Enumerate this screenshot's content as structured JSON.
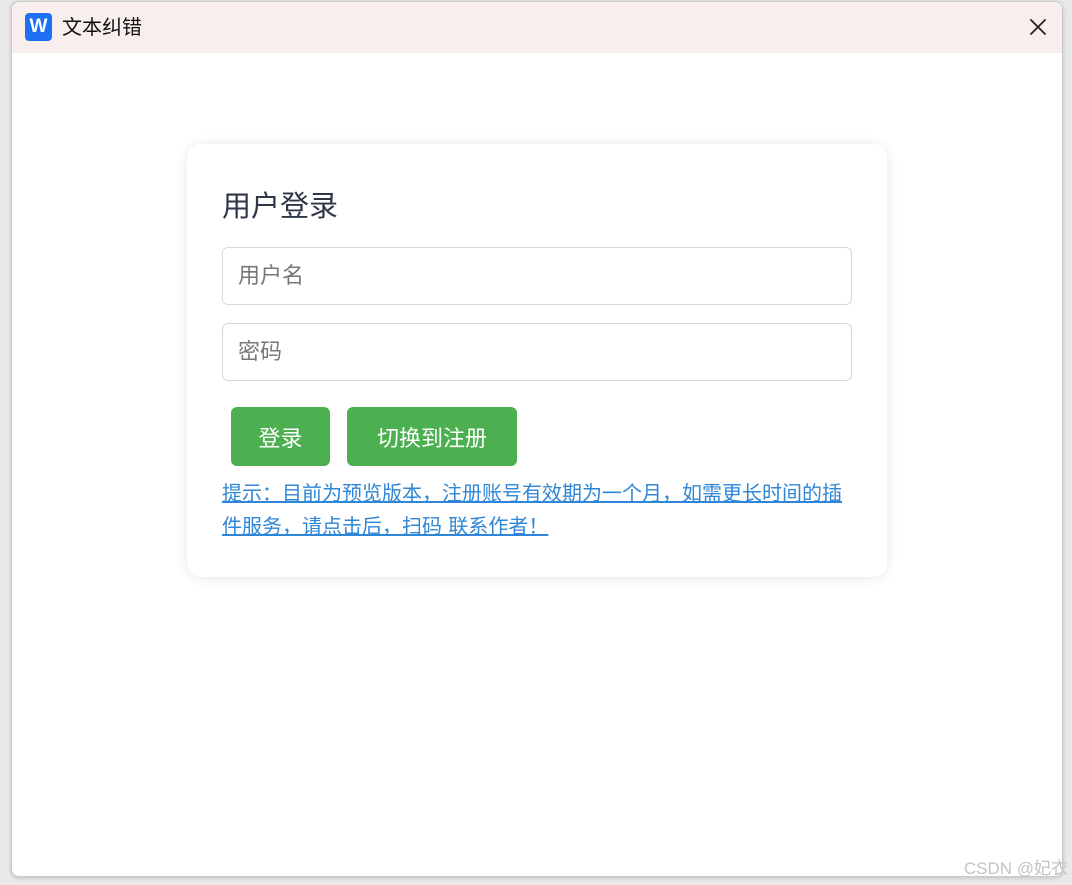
{
  "window": {
    "title": "文本纠错",
    "logo_letter": "W",
    "logo_color": "#1e6ff2",
    "close_icon": "close-icon"
  },
  "login": {
    "title": "用户登录",
    "username_placeholder": "用户名",
    "password_placeholder": "密码",
    "login_button": "登录",
    "switch_button": "切换到注册",
    "button_color": "#4caf50",
    "hint": "提示：目前为预览版本，注册账号有效期为一个月，如需更长时间的插件服务，请点击后，扫码 联系作者！",
    "hint_color": "#2f86d6"
  },
  "watermark": "CSDN @妃衣"
}
